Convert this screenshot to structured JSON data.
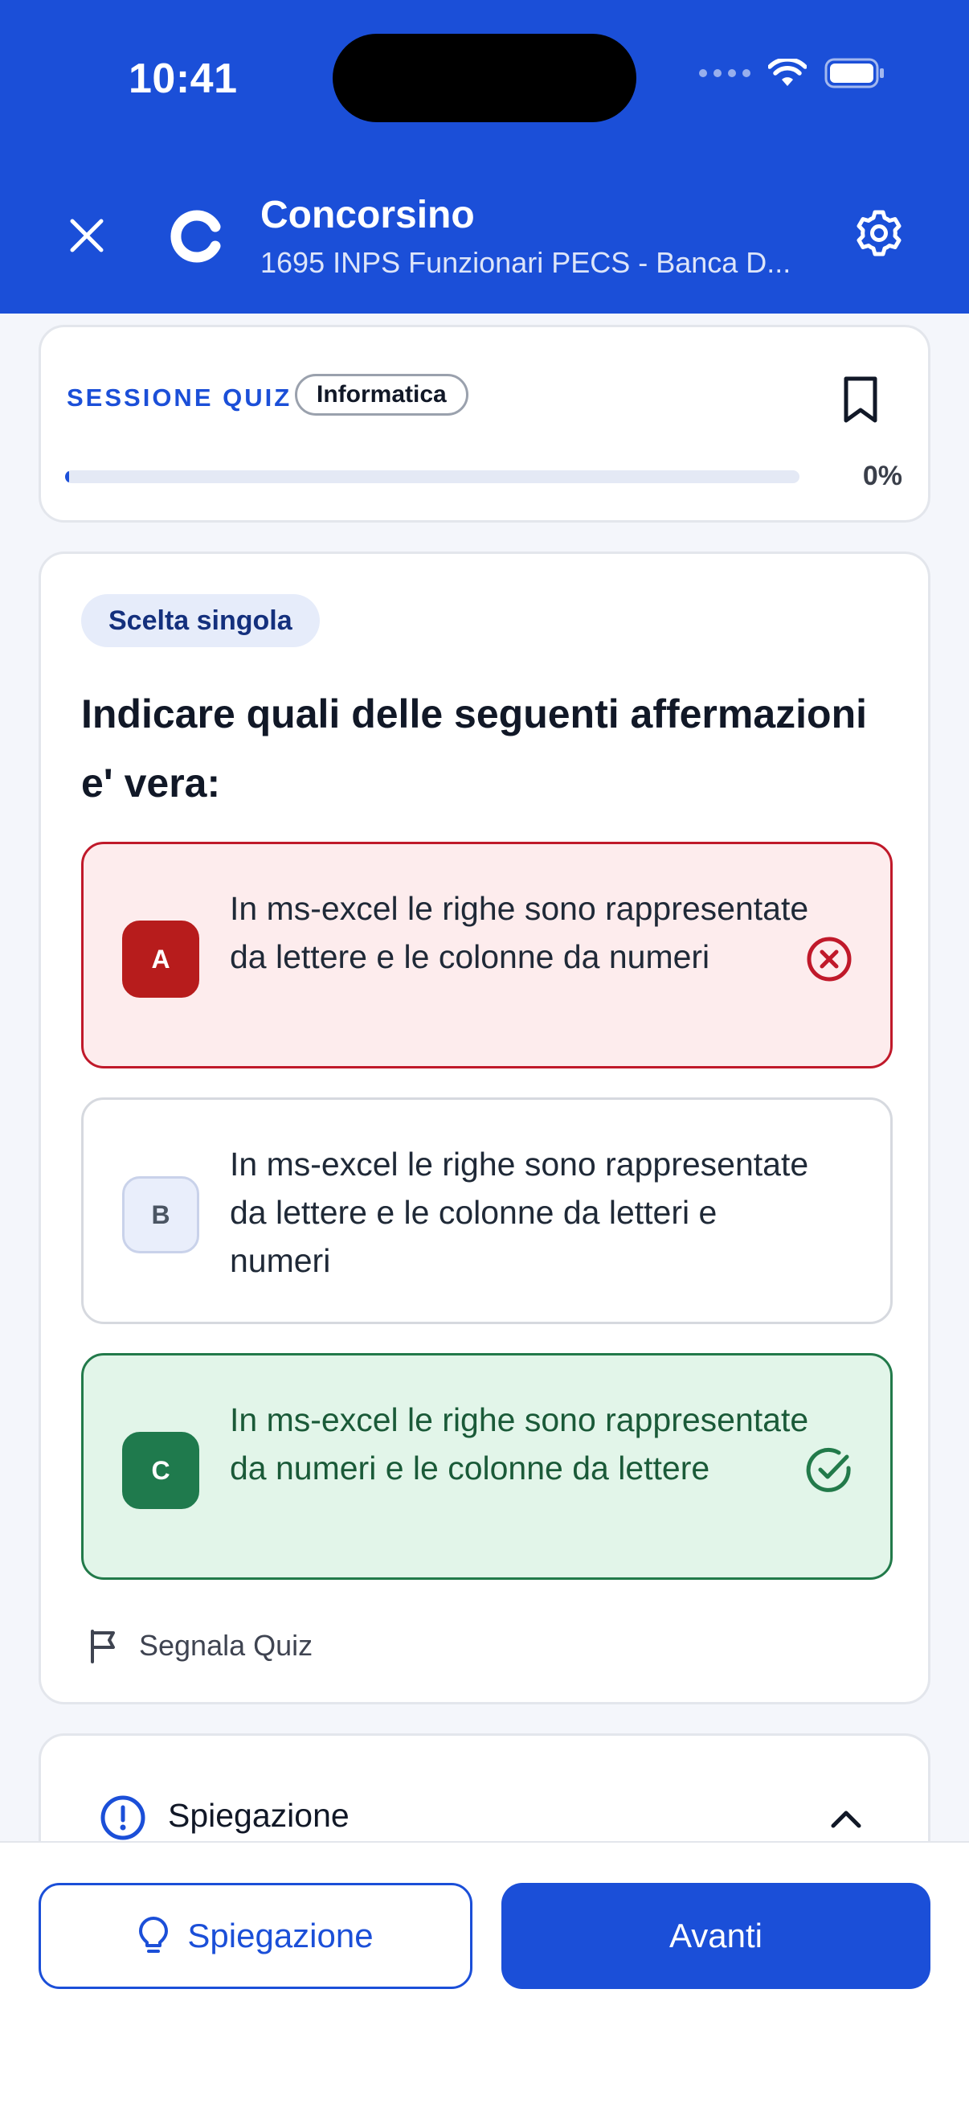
{
  "status_bar": {
    "time": "10:41"
  },
  "header": {
    "title": "Concorsino",
    "subtitle": "1695 INPS Funzionari PECS - Banca D..."
  },
  "session": {
    "label": "SESSIONE QUIZ",
    "topic": "Informatica",
    "progress_text": "0%",
    "progress_fraction": 0.005
  },
  "question": {
    "type": "Scelta singola",
    "text": "Indicare quali delle seguenti affermazioni e' vera:",
    "options": [
      {
        "letter": "A",
        "text": "In ms-excel le righe sono rappresentate da lettere e le colonne da numeri",
        "state": "wrong"
      },
      {
        "letter": "B",
        "text": "In ms-excel le righe sono rappresentate da lettere e le colonne da letteri e numeri",
        "state": "neutral"
      },
      {
        "letter": "C",
        "text": "In ms-excel le righe sono rappresentate da numeri e le colonne da lettere",
        "state": "correct"
      }
    ],
    "report_label": "Segnala Quiz"
  },
  "explanation": {
    "title": "Spiegazione"
  },
  "bottom": {
    "explanation_button": "Spiegazione",
    "next_button": "Avanti"
  },
  "colors": {
    "primary": "#1b4fd8",
    "wrong": "#c0192a",
    "correct": "#227a4a"
  }
}
